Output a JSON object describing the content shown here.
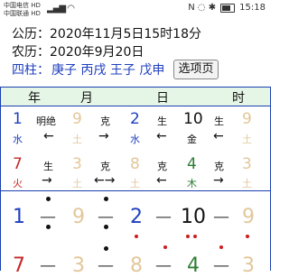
{
  "status": {
    "carrier1": "中国电信 HD",
    "carrier2": "中国联通 HD",
    "icons": "N ◌ ✱",
    "battery": "40",
    "time": "15:18"
  },
  "info": {
    "gongli": "公历：2020年11月5日15时18分",
    "nongli": "农历：2020年9月20日",
    "sizhu_label": "四柱：",
    "sizhu_values": "庚子 丙戌 王子 戊申",
    "options_button": "选项页"
  },
  "header": {
    "year": "年",
    "month": "月",
    "day": "日",
    "hour": "时"
  },
  "row1": {
    "c1_num": "1",
    "c1_elem": "水",
    "c2_top": "明绝",
    "c2_arrow": "←",
    "c3_num": "9",
    "c3_elem": "土",
    "c4_top": "克",
    "c4_arrow": "→",
    "c5_num": "2",
    "c5_elem": "水",
    "c6_top": "生",
    "c6_arrow": "←",
    "c7_num": "10",
    "c7_elem": "金",
    "c8_top": "生",
    "c8_arrow": "←",
    "c9_num": "9",
    "c9_elem": "土"
  },
  "row2": {
    "c1_num": "7",
    "c1_elem": "火",
    "c2_top": "生",
    "c2_arrow": "→",
    "c3_num": "3",
    "c3_elem": "土",
    "c4_top": "克",
    "c4_arrow": "←→",
    "c5_num": "8",
    "c5_elem": "土",
    "c6_top": "克",
    "c6_arrow": "←",
    "c7_num": "4",
    "c7_elem": "木",
    "c8_top": "克",
    "c8_arrow": "→",
    "c9_num": "3",
    "c9_elem": "土"
  },
  "row3": {
    "n1": "1",
    "n2": "9",
    "n3": "2",
    "n4": "10",
    "n5": "9",
    "dash": "—"
  },
  "row4": {
    "n1": "7",
    "n2": "3",
    "n3": "8",
    "n4": "4",
    "n5": "3",
    "dash": "—"
  }
}
